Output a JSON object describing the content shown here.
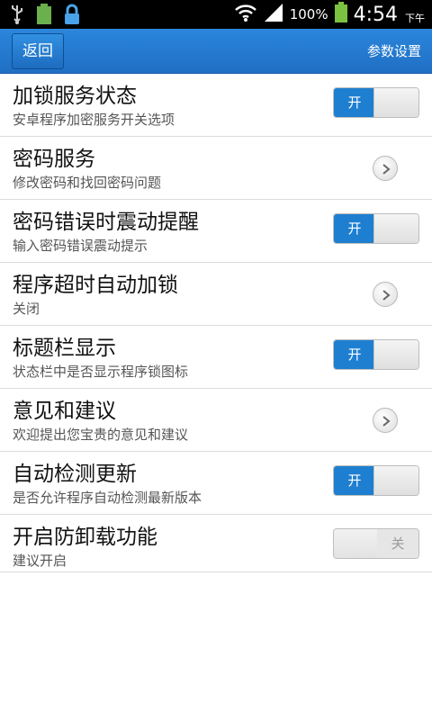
{
  "status_bar": {
    "battery_percent": "100%",
    "time": "4:54",
    "ampm": "下午"
  },
  "titlebar": {
    "back_label": "返回",
    "title": "参数设置"
  },
  "colors": {
    "accent": "#1e7fd1",
    "titlebar": "#2478cf"
  },
  "settings": [
    {
      "title": "加锁服务状态",
      "subtitle": "安卓程序加密服务开关选项",
      "control": "toggle",
      "state": "on",
      "state_label": "开"
    },
    {
      "title": "密码服务",
      "subtitle": "修改密码和找回密码问题",
      "control": "arrow"
    },
    {
      "title": "密码错误时震动提醒",
      "subtitle": "输入密码错误震动提示",
      "control": "toggle",
      "state": "on",
      "state_label": "开"
    },
    {
      "title": "程序超时自动加锁",
      "subtitle": "关闭",
      "control": "arrow"
    },
    {
      "title": "标题栏显示",
      "subtitle": "状态栏中是否显示程序锁图标",
      "control": "toggle",
      "state": "on",
      "state_label": "开"
    },
    {
      "title": "意见和建议",
      "subtitle": "欢迎提出您宝贵的意见和建议",
      "control": "arrow"
    },
    {
      "title": "自动检测更新",
      "subtitle": "是否允许程序自动检测最新版本",
      "control": "toggle",
      "state": "on",
      "state_label": "开"
    },
    {
      "title": "开启防卸载功能",
      "subtitle": "建议开启",
      "control": "toggle",
      "state": "off",
      "state_label": "关"
    }
  ]
}
